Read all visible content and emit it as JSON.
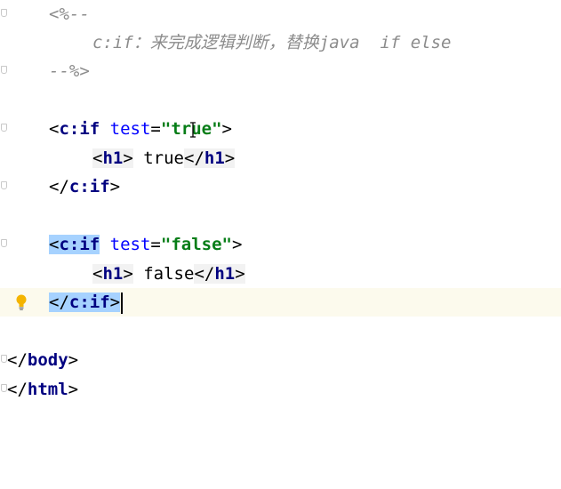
{
  "editor": {
    "lines": {
      "comment_open": "<%--",
      "comment_body_prefix": "c:if",
      "comment_body_cjk": "：来完成逻辑判断，替换",
      "comment_body_suffix": "java  if else",
      "comment_close": "--%>",
      "if1_lt": "<",
      "if1_tag": "c:if",
      "if1_attr": " test",
      "if1_eq": "=",
      "if1_val": "\"true\"",
      "if1_gt": ">",
      "h1a_open_lt": "<",
      "h1a_open_tag": "h1",
      "h1a_open_gt": ">",
      "h1a_text": " true",
      "h1a_close_lt": "</",
      "h1a_close_tag": "h1",
      "h1a_close_gt": ">",
      "if1_close_lt": "</",
      "if1_close_tag": "c:if",
      "if1_close_gt": ">",
      "if2_lt": "<",
      "if2_tag": "c:if",
      "if2_attr": " test",
      "if2_eq": "=",
      "if2_val": "\"false\"",
      "if2_gt": ">",
      "h1b_open_lt": "<",
      "h1b_open_tag": "h1",
      "h1b_open_gt": ">",
      "h1b_text": " false",
      "h1b_close_lt": "</",
      "h1b_close_tag": "h1",
      "h1b_close_gt": ">",
      "if2_close_lt": "</",
      "if2_close_tag": "c:if",
      "if2_close_gt": ">",
      "body_close_lt": "</",
      "body_close_tag": "body",
      "body_close_gt": ">",
      "html_close_lt": "</",
      "html_close_tag": "html",
      "html_close_gt": ">"
    },
    "icons": {
      "fold_marker": "fold-marker-icon",
      "intention_bulb": "lightbulb-icon",
      "mouse_cursor": "text-cursor-icon"
    },
    "colors": {
      "tag": "#000080",
      "attribute": "#0000ff",
      "string": "#067d17",
      "comment": "#8c8c8c",
      "selection": "#a6d2ff",
      "current_line": "#fcfaed",
      "bulb": "#f4b400"
    }
  }
}
